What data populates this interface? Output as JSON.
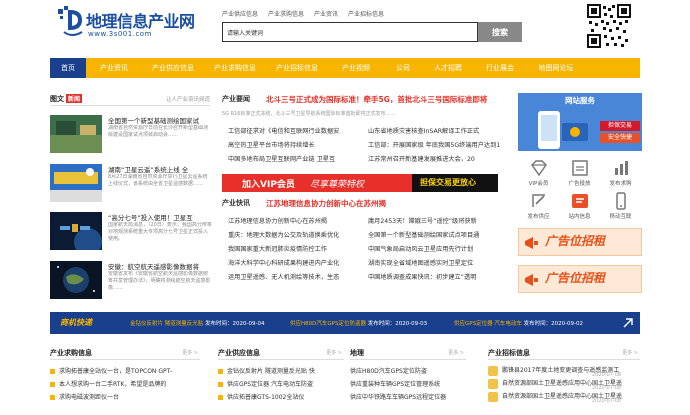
{
  "logo": {
    "title": "地理信息产业网",
    "url": "www.3s001.com"
  },
  "search": {
    "tabs": [
      "产业供应信息",
      "产业求购信息",
      "产业资讯",
      "产业招标信息"
    ],
    "value": "请输入关键词",
    "button": "搜索"
  },
  "nav": [
    "首页",
    "产业资讯",
    "产业供应信息",
    "产业求购信息",
    "产业招标信息",
    "产业视频",
    "公司",
    "人才招聘",
    "行业展会",
    "地图网论坛"
  ],
  "left": {
    "title_a": "图文",
    "title_b": "新闻",
    "sub": "让人产业资讯频道",
    "items": [
      {
        "title": "全国第一个新型基础测绘国家试",
        "desc": "湖南省自然资源厅日前在长沙召开新型基础测绘建设国家试点项目启动会……"
      },
      {
        "title": "湖南“卫星云遥”系统上线 全",
        "desc": "8月27日湖南省自然资源厅举行卫星云遥系统上线仪式，该系统由全省卫星遥感数据……"
      },
      {
        "title": "“高分七号”投入使用！卫星互",
        "desc": "国家航天局消息，（20日）表示，我国高分辨率对地观测系统重大专项高分七号卫星正式投入使用。"
      },
      {
        "title": "安徽：航空航天遥感影像数据将",
        "desc": "安徽省发布《安徽省航空航天遥感影像数据统筹共享管理办法》，明确将测绘航空航天遥感影像……"
      }
    ]
  },
  "middle": {
    "label1": "产业要闻",
    "headline1": "北斗三号正式成为国际标准！牵手5G，首批北斗三号国际标准即将",
    "summary": "5G R16标准正式冻结，北斗三号卫星导航系统国际标准首批即将正式发布……",
    "links1": [
      [
        "工信部征求对《电信和互联网行业数据安",
        "山东省地质灾害核查InSAR解译工作正式"
      ],
      [
        "高空热卫星平台市场将持续增长",
        "工信部：开展国家级 年底我国5G终端用户达到1"
      ],
      [
        "中国多地布局卫星互联网产业链 卫星互",
        "江苏常州召开新基建发展推进大会，20"
      ]
    ],
    "vip": {
      "a": "加入VIP会员",
      "b": "尽享尊荣特权",
      "c": "担保交易更放心"
    },
    "label2": "产业快讯",
    "headline2": "江苏地理信息协力创新中心在苏州揭",
    "links2": [
      [
        "江苏地理信息协力创新中心在苏州揭",
        "庸月2453天！嫦娥三号“遥控”级将获新"
      ],
      [
        "重庆：地理大数据为公交及轨道换乘优化",
        "全国第一个新型基础测绘国家试点项目通"
      ],
      [
        "我国国家重大新冠肺炎疫情防控工作",
        "中国气象局启动风云卫星应用先行计划"
      ],
      [
        "海洋大科学中心科研成果构建进内产业化",
        "湖南实现全省域地图遥感实时卫星定位"
      ],
      [
        "运用卫星遥感、无人机测绘等技术，生态",
        "中国地质调查成果快讯：初步建立“透明"
      ]
    ]
  },
  "right": {
    "banner_title": "网站服务",
    "badge1": "担保交易",
    "badge2": "安全快捷",
    "icons": [
      {
        "name": "vip-icon",
        "label": "VIP会员"
      },
      {
        "name": "ad-service-icon",
        "label": "广告投放"
      },
      {
        "name": "publish-icon",
        "label": "发布求购"
      },
      {
        "name": "post-supply-icon",
        "label": "发布供应"
      },
      {
        "name": "shop-icon",
        "label": "站内信息"
      },
      {
        "name": "mobile-icon",
        "label": "移动互联"
      }
    ],
    "ad1": "广告位招租",
    "ad2": "广告位招租"
  },
  "ticker": {
    "label": "商机快递",
    "items": [
      {
        "hl": "金钻仪反射片 隧道测量反光贴",
        "time": "发布时间：2020-09-04"
      },
      {
        "hl": "供应H80D汽车GPS定位防盗器",
        "time": "发布时间：2020-09-03"
      },
      {
        "hl": "供应GPS定位器 汽车电动车",
        "time": "发布时间：2020-09-02"
      }
    ]
  },
  "bottom": {
    "col1": {
      "title": "产业求购信息",
      "more": "更多 >",
      "items": [
        "求购拓普康全站仪一台，是TOPCON GPT-",
        "本人想求购一台二手RTK，希望是品牌的",
        "求购电磁波测距仪一台"
      ]
    },
    "col2": {
      "title": "产业供应信息",
      "more": "更多 >",
      "items": [
        "金钻仪反射片 隧道测量反光贴 快",
        "供应GPS定位器 汽车电动车防盗",
        "供应拓普康GTS-1002全站仪"
      ]
    },
    "col3": {
      "title": "地理",
      "more": "更多 >",
      "items": [
        "供应H80D汽车GPS定位防盗",
        "供应重装种车辆GPS定位管理系统",
        "供应中华铁路车车辆GPS远程定位器"
      ]
    },
    "col4": {
      "title": "产业招标信息",
      "more": "更多 >",
      "items": [
        {
          "text": "鹏锋县2017年度土地变更调查与遥感监测工",
          "date": "2020-07-08"
        },
        {
          "text": "自然资源部国土卫星遥感应用中心国土卫星遥",
          "date": "2020-07-08"
        },
        {
          "text": "自然资源部国土卫星遥感应用中心国土卫星遥",
          "date": "2020-07-08"
        }
      ]
    }
  },
  "colors": {
    "nav_yellow": "#f7b500",
    "nav_active": "#1a3f8c",
    "accent_red": "#e0332b"
  }
}
